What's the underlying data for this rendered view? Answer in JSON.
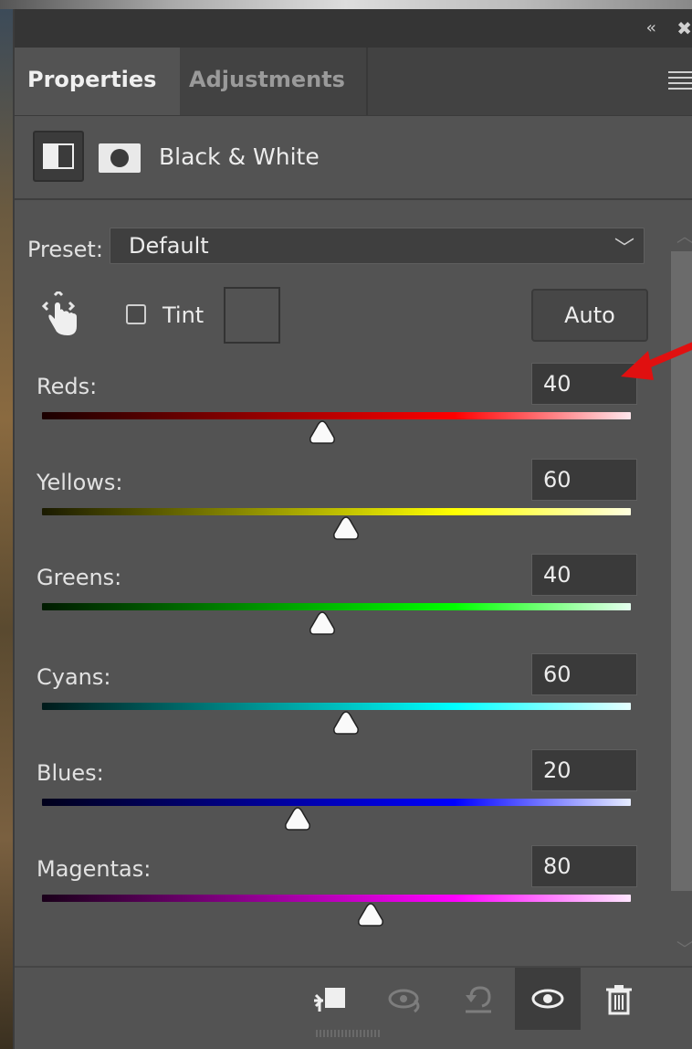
{
  "window": {
    "collapse_glyph": "‹‹",
    "close_glyph": "✖"
  },
  "tabs": [
    {
      "label": "Properties",
      "active": true
    },
    {
      "label": "Adjustments",
      "active": false
    }
  ],
  "header": {
    "title": "Black & White",
    "icon": "black-white-adjustment-icon",
    "mask_icon": "layer-mask-icon"
  },
  "preset": {
    "label": "Preset:",
    "value": "Default"
  },
  "tint": {
    "label": "Tint",
    "checked": false
  },
  "auto_button": {
    "label": "Auto"
  },
  "sliders": [
    {
      "label": "Reds:",
      "value": "40",
      "colors": [
        "#1a0000",
        "#ff0000",
        "#ffe6ec"
      ],
      "position": 0.476
    },
    {
      "label": "Yellows:",
      "value": "60",
      "colors": [
        "#1a1a00",
        "#ffff00",
        "#ffffe0"
      ],
      "position": 0.516
    },
    {
      "label": "Greens:",
      "value": "40",
      "colors": [
        "#001a00",
        "#00ff00",
        "#e6fff0"
      ],
      "position": 0.476
    },
    {
      "label": "Cyans:",
      "value": "60",
      "colors": [
        "#001a1a",
        "#00ffff",
        "#e6ffff"
      ],
      "position": 0.516
    },
    {
      "label": "Blues:",
      "value": "20",
      "colors": [
        "#00001a",
        "#0000ff",
        "#e6ecff"
      ],
      "position": 0.434
    },
    {
      "label": "Magentas:",
      "value": "80",
      "colors": [
        "#1a001a",
        "#ff00ff",
        "#ffe6ff"
      ],
      "position": 0.558
    }
  ],
  "footer_icons": [
    "clip-to-layer-icon",
    "view-previous-state-icon",
    "reset-icon",
    "visibility-eye-icon",
    "delete-icon"
  ],
  "annotation": {
    "color": "#e01010"
  }
}
